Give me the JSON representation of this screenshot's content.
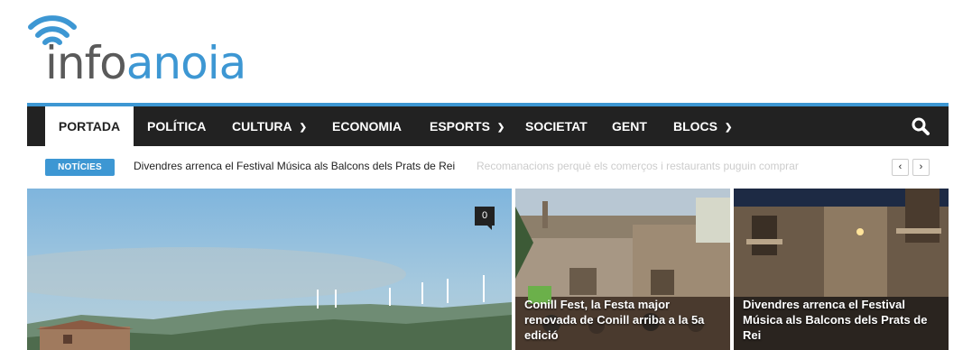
{
  "logo": {
    "part1": "info",
    "part2": "anoia"
  },
  "nav": {
    "items": [
      {
        "label": "PORTADA",
        "dropdown": false
      },
      {
        "label": "POLÍTICA",
        "dropdown": false
      },
      {
        "label": "CULTURA",
        "dropdown": true
      },
      {
        "label": "ECONOMIA",
        "dropdown": false
      },
      {
        "label": "ESPORTS",
        "dropdown": true
      },
      {
        "label": "SOCIETAT",
        "dropdown": false
      },
      {
        "label": "GENT",
        "dropdown": false
      },
      {
        "label": "BLOCS",
        "dropdown": true
      }
    ],
    "search_icon": "search-icon"
  },
  "ticker": {
    "badge": "NOTÍCIES",
    "headline": "Divendres arrenca el Festival Música als Balcons dels Prats de Rei",
    "next_headline": "Recomanacions perquè els comerços i restaurants puguin comprar",
    "prev_icon": "chevron-left-icon",
    "next_icon": "chevron-right-icon"
  },
  "featured": [
    {
      "title": "",
      "comments": "0"
    },
    {
      "title": "Conill Fest, la Festa major renovada de Conill arriba a la 5a edició"
    },
    {
      "title": "Divendres arrenca el Festival Música als Balcons dels Prats de Rei"
    }
  ],
  "colors": {
    "accent": "#3d97d3",
    "nav_bg": "#222222",
    "logo_grey": "#5a5a5a"
  }
}
